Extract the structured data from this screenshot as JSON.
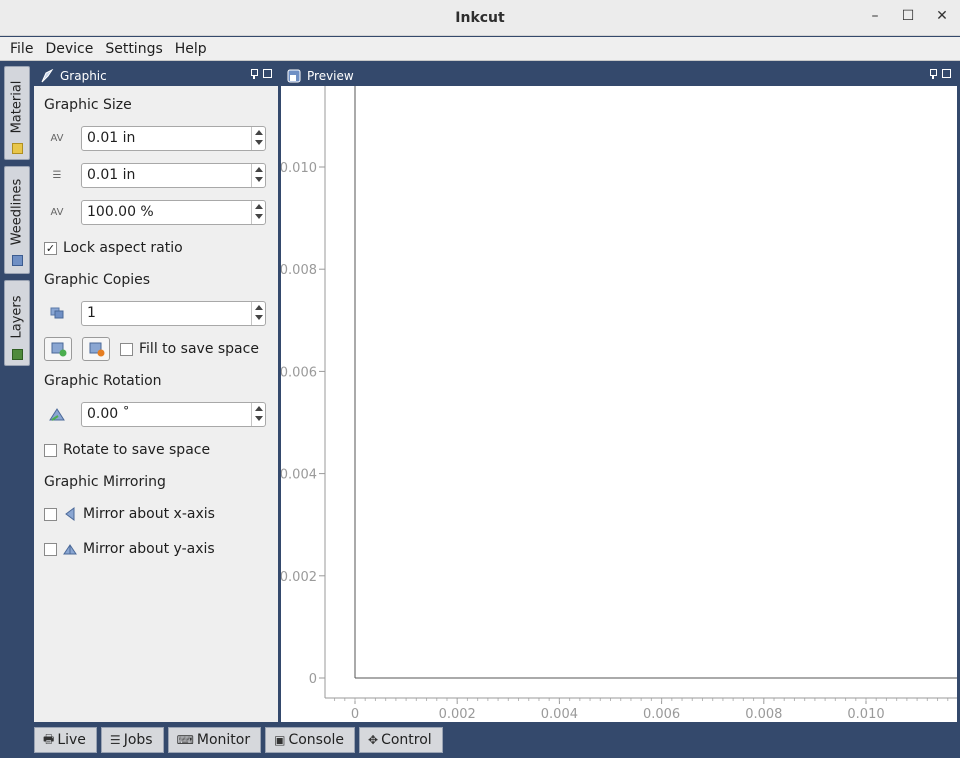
{
  "window": {
    "title": "Inkcut"
  },
  "menu": [
    "File",
    "Device",
    "Settings",
    "Help"
  ],
  "side_tabs": [
    "Material",
    "Weedlines",
    "Layers"
  ],
  "graphic_panel": {
    "title": "Graphic",
    "size_section": "Graphic Size",
    "width_value": "0.01 in",
    "height_value": "0.01 in",
    "scale_value": "100.00 %",
    "lock_aspect_label": "Lock aspect ratio",
    "lock_aspect_checked": true,
    "copies_section": "Graphic Copies",
    "copies_value": "1",
    "fill_label": "Fill to save space",
    "rotation_section": "Graphic Rotation",
    "rotation_value": "0.00 ˚",
    "rotate_label": "Rotate to save space",
    "mirroring_section": "Graphic Mirroring",
    "mirror_x_label": "Mirror about x-axis",
    "mirror_y_label": "Mirror about y-axis"
  },
  "preview": {
    "title": "Preview",
    "x_ticks": [
      "0",
      "0.002",
      "0.004",
      "0.006",
      "0.008",
      "0.010"
    ],
    "y_ticks": [
      "0",
      "0.002",
      "0.004",
      "0.006",
      "0.008",
      "0.010"
    ]
  },
  "bottom_tabs": [
    "Live",
    "Jobs",
    "Monitor",
    "Console",
    "Control"
  ],
  "colors": {
    "accent": "#34496c",
    "panel": "#efefef"
  }
}
